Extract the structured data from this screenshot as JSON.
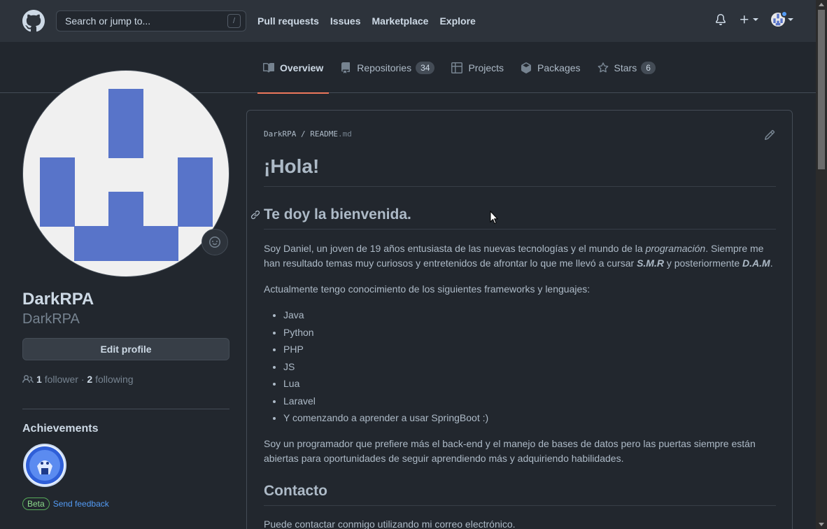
{
  "header": {
    "search_placeholder": "Search or jump to...",
    "search_shortcut": "/",
    "nav": [
      "Pull requests",
      "Issues",
      "Marketplace",
      "Explore"
    ]
  },
  "tabs": [
    {
      "label": "Overview",
      "icon": "book-icon",
      "active": true
    },
    {
      "label": "Repositories",
      "icon": "repo-icon",
      "count": "34"
    },
    {
      "label": "Projects",
      "icon": "table-icon"
    },
    {
      "label": "Packages",
      "icon": "package-icon"
    },
    {
      "label": "Stars",
      "icon": "star-icon",
      "count": "6"
    }
  ],
  "profile": {
    "name": "DarkRPA",
    "login": "DarkRPA",
    "edit_label": "Edit profile",
    "followers_count": "1",
    "followers_label": "follower",
    "separator": "·",
    "following_count": "2",
    "following_label": "following",
    "achievements_title": "Achievements",
    "beta_label": "Beta",
    "feedback_label": "Send feedback"
  },
  "readme": {
    "owner": "DarkRPA",
    "slash": "/",
    "file_base": "README",
    "file_ext": ".md",
    "h1": "¡Hola!",
    "h2_welcome": "Te doy la bienvenida.",
    "p1_a": "Soy Daniel, un joven de 19 años entusiasta de las nuevas tecnologías y el mundo de la ",
    "p1_em": "programación",
    "p1_b": ". Siempre me han resultado temas muy curiosos y entretenidos de afrontar lo que me llevó a cursar ",
    "p1_smr": "S.M.R",
    "p1_c": " y posteriormente ",
    "p1_dam": "D.A.M",
    "p1_d": ".",
    "p2": "Actualmente tengo conocimiento de los siguientes frameworks y lenguajes:",
    "list": [
      "Java",
      "Python",
      "PHP",
      "JS",
      "Lua",
      "Laravel",
      "Y comenzando a aprender a usar SpringBoot :)"
    ],
    "p3": "Soy un programador que prefiere más el back-end y el manejo de bases de datos pero las puertas siempre están abiertas para oportunidades de seguir aprendiendo más y adquiriendo habilidades.",
    "h2_contact": "Contacto",
    "p4": "Puede contactar conmigo utilizando mi correo electrónico."
  },
  "colors": {
    "accent_underline": "#ec775c",
    "avatar_blue": "#5874c9",
    "link": "#539bf5"
  }
}
